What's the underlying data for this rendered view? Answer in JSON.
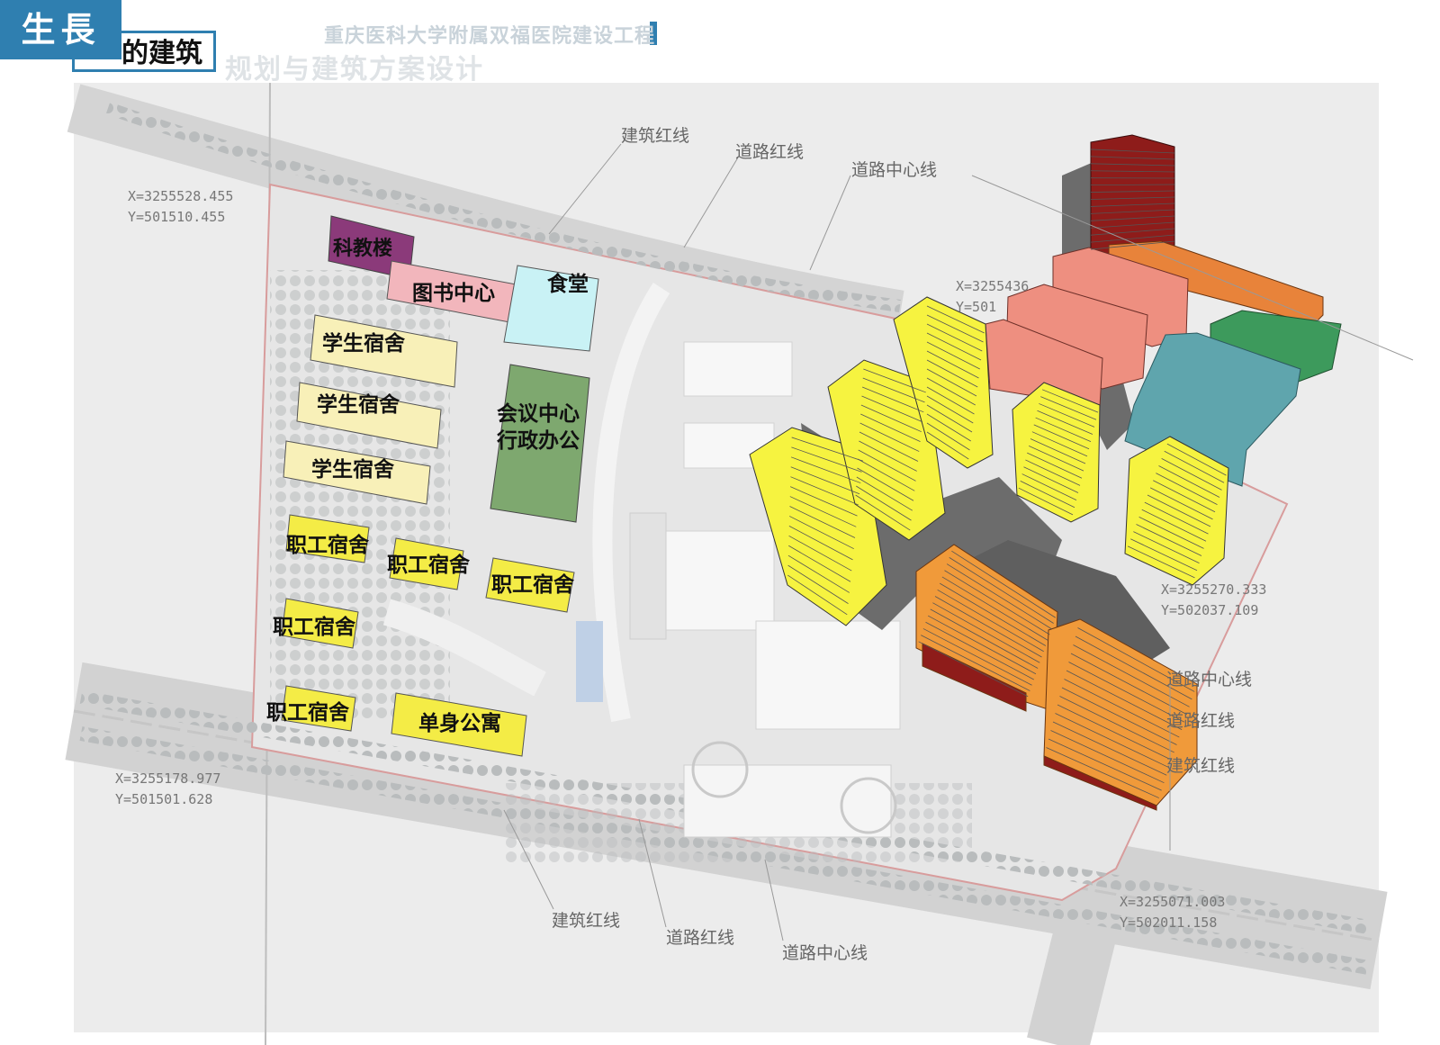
{
  "header": {
    "badge": "生長",
    "badge_suffix": "的建筑",
    "project": "重庆医科大学附属双福医院建设工程",
    "subtitle": "规划与建筑方案设计"
  },
  "buildings": {
    "research": "科教楼",
    "library": "图书中心",
    "canteen": "食堂",
    "student1": "学生宿舍",
    "student2": "学生宿舍",
    "student3": "学生宿舍",
    "conference1": "会议中心",
    "conference2": "行政办公",
    "staff1": "职工宿舍",
    "staff2": "职工宿舍",
    "staff3": "职工宿舍",
    "staff4": "职工宿舍",
    "staff5": "职工宿舍",
    "single": "单身公寓"
  },
  "annotations": {
    "top_building_line": "建筑红线",
    "top_road_line": "道路红线",
    "top_center_line": "道路中心线",
    "right_center_line": "道路中心线",
    "right_road_line": "道路红线",
    "right_building_line": "建筑红线",
    "bottom_building_line": "建筑红线",
    "bottom_road_line": "道路红线",
    "bottom_center_line": "道路中心线"
  },
  "coordinates": {
    "nw": "X=3255528.455\nY=501510.455",
    "ne": "X=3255436\nY=501",
    "e": "X=3255270.333\nY=502037.109",
    "sw": "X=3255178.977\nY=501501.628",
    "se": "X=3255071.003\nY=502011.158"
  },
  "colors": {
    "header_blue": "#2f7fb0",
    "yellow": "#f6f340",
    "dark_red": "#8e1c1a",
    "orange": "#e8833a",
    "salmon": "#ee8f80",
    "green": "#3d9a5c",
    "teal": "#5fa5ad",
    "purple": "#8b3a7a",
    "pink": "#f2b6bc",
    "cyan": "#c9f2f5",
    "sage": "#7ea86f"
  }
}
